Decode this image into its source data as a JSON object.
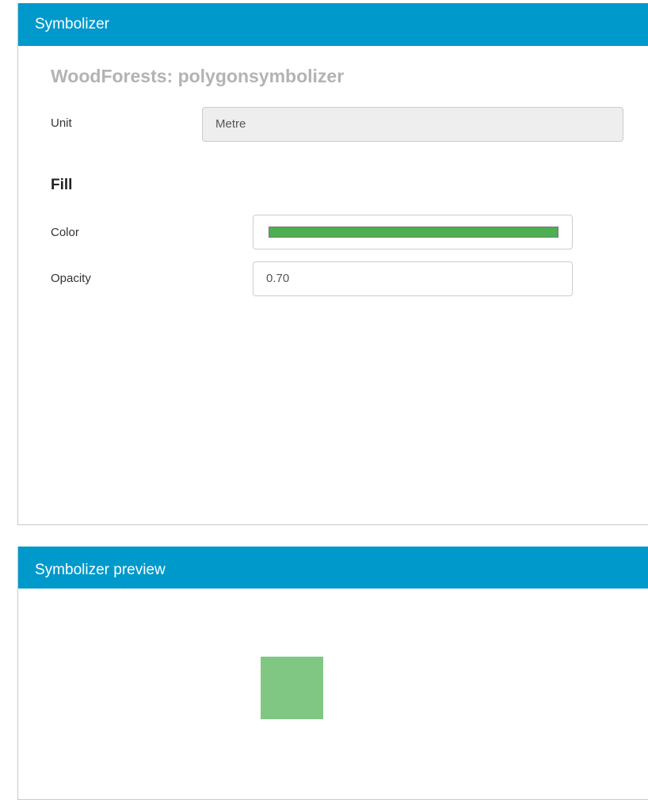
{
  "symbolizer_panel": {
    "header_title": "Symbolizer",
    "symbolizer_name": "WoodForests: polygonsymbolizer",
    "unit": {
      "label": "Unit",
      "value": "Metre"
    },
    "fill": {
      "heading": "Fill",
      "color": {
        "label": "Color",
        "value": "#4caf50"
      },
      "opacity": {
        "label": "Opacity",
        "value": "0.70"
      }
    }
  },
  "preview_panel": {
    "header_title": "Symbolizer preview",
    "preview_fill_color": "#4caf50",
    "preview_opacity": 0.7
  }
}
